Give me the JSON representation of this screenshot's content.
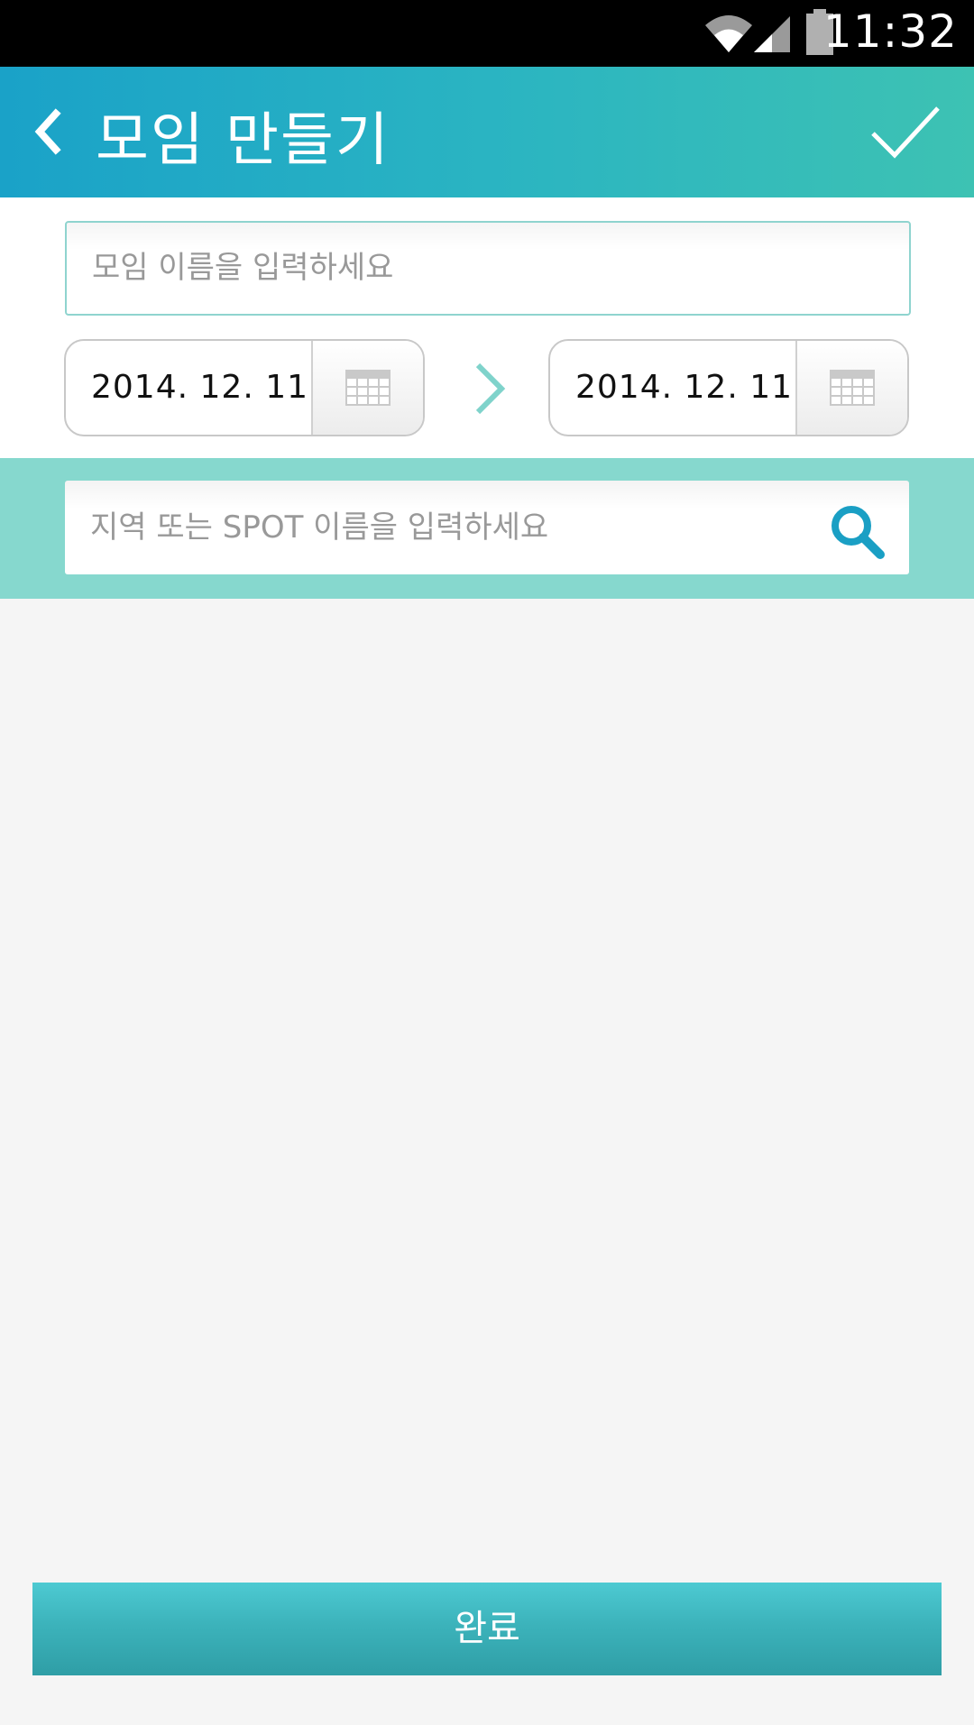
{
  "status_bar": {
    "time": "11:32",
    "icons": [
      "wifi-icon",
      "signal-icon",
      "battery-icon"
    ]
  },
  "app_bar": {
    "title": "모임 만들기",
    "back_icon": "chevron-left-icon",
    "confirm_icon": "check-icon",
    "gradient": [
      "#1aa2c8",
      "#3dc2b3"
    ]
  },
  "form": {
    "name_placeholder": "모임 이름을 입력하세요",
    "start_date": "2014. 12. 11",
    "end_date": "2014. 12. 11",
    "calendar_icon": "calendar-icon",
    "range_icon": "chevron-right-icon"
  },
  "search": {
    "placeholder": "지역 또는 SPOT 이름을 입력하세요",
    "icon": "search-icon",
    "band_color": "#86d8ce"
  },
  "footer": {
    "complete_label": "완료"
  },
  "colors": {
    "accent": "#1a9fc4",
    "teal": "#86d8ce"
  }
}
